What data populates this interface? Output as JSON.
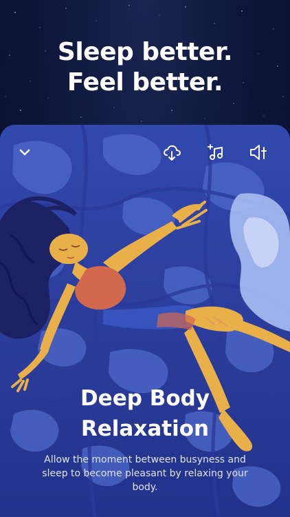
{
  "headline": {
    "line1": "Sleep better.",
    "line2": "Feel better."
  },
  "player": {
    "icons": {
      "collapse": "chevron-down-icon",
      "download": "cloud-download-icon",
      "music": "music-note-icon",
      "volume": "volume-adjust-icon"
    }
  },
  "session": {
    "title_line1": "Deep Body",
    "title_line2": "Relaxation",
    "description": "Allow the moment between busyness and sleep to become pleasant by relaxing your body."
  },
  "colors": {
    "sky": "#0c1436",
    "card": "#2b3d9c",
    "water_light": "#5b78d6",
    "skin": "#e9b04a",
    "hair": "#1c2164",
    "swimsuit": "#d2684e"
  }
}
